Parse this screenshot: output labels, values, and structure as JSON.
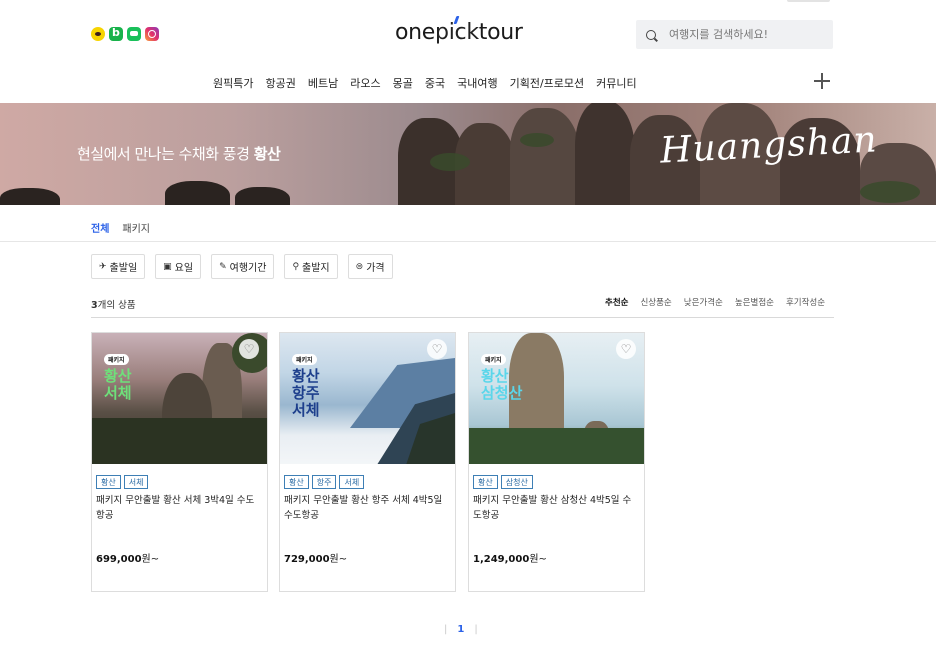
{
  "header": {
    "logo_prefix": "one",
    "logo_pick": "pick",
    "logo_suffix": "tour",
    "search_placeholder": "여행지를 검색하세요!",
    "nav": [
      "원픽특가",
      "항공권",
      "베트남",
      "라오스",
      "몽골",
      "중국",
      "국내여행",
      "기획전/프로모션",
      "커뮤니티"
    ],
    "sns_icons": [
      "kakao-icon",
      "naver-blog-icon",
      "kakaotalk-icon",
      "instagram-icon"
    ]
  },
  "banner": {
    "text": "현실에서 만나는 수채화 풍경",
    "highlight": "황산",
    "script": "Huangshan"
  },
  "tabs": [
    "전체",
    "패키지"
  ],
  "filters": [
    {
      "icon": "plane-icon",
      "glyph": "✈",
      "label": "출발일"
    },
    {
      "icon": "calendar-icon",
      "glyph": "▣",
      "label": "요일"
    },
    {
      "icon": "pencil-icon",
      "glyph": "✎",
      "label": "여행기간"
    },
    {
      "icon": "pin-icon",
      "glyph": "⚲",
      "label": "출발지"
    },
    {
      "icon": "won-icon",
      "glyph": "⊜",
      "label": "가격"
    }
  ],
  "results": {
    "count": "3",
    "count_suffix": "개의 상품",
    "sorts": [
      "추천순",
      "신상품순",
      "낮은가격순",
      "높은별점순",
      "후기작성순"
    ]
  },
  "products": [
    {
      "badge": "패키지",
      "thumb_title": "황산\n서체",
      "thumb_title_color": "#6ee07a",
      "tags": [
        "황산",
        "서체"
      ],
      "name": "패키지 무안출발 황산 서체 3박4일 수도항공",
      "price": "699,000",
      "price_suffix": "원~"
    },
    {
      "badge": "패키지",
      "thumb_title": "황산\n항주\n서체",
      "thumb_title_color": "#1d3f8c",
      "tags": [
        "황산",
        "항주",
        "서체"
      ],
      "name": "패키지 무안출발 황산 항주 서체 4박5일 수도항공",
      "price": "729,000",
      "price_suffix": "원~"
    },
    {
      "badge": "패키지",
      "thumb_title": "황산\n삼청산",
      "thumb_title_color": "#5ad6ea",
      "tags": [
        "황산",
        "삼청산"
      ],
      "name": "패키지 무안출발 황산 삼청산 4박5일 수도항공",
      "price": "1,249,000",
      "price_suffix": "원~"
    }
  ],
  "pagination": {
    "current": "1"
  }
}
